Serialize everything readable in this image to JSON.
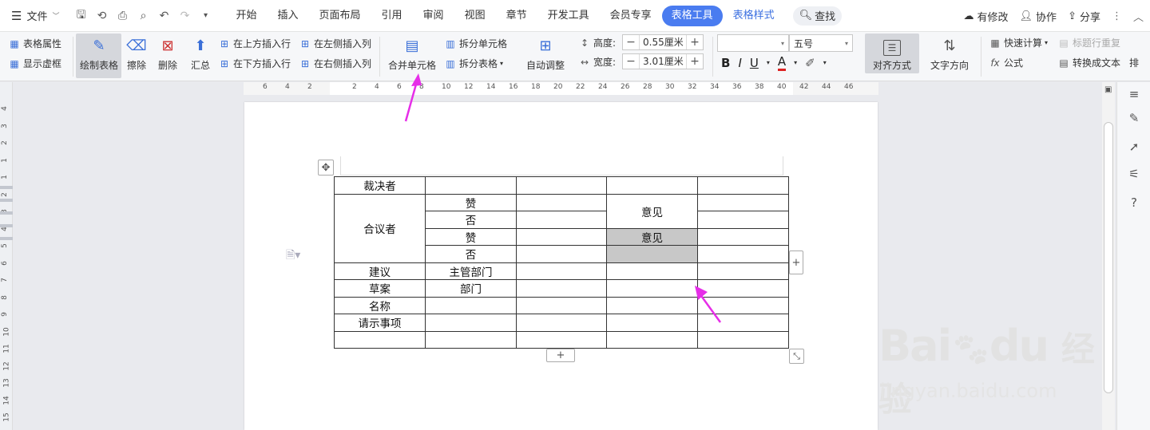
{
  "menubar": {
    "file_label": "文件",
    "tabs": [
      "开始",
      "插入",
      "页面布局",
      "引用",
      "审阅",
      "视图",
      "章节",
      "开发工具",
      "会员专享"
    ],
    "active_tab": "表格工具",
    "style_tab": "表格样式",
    "search_label": "查找",
    "right_items": {
      "modified": "有修改",
      "collab": "协作",
      "share": "分享"
    }
  },
  "ribbon": {
    "table_props": "表格属性",
    "show_gridlines": "显示虚框",
    "draw_table": "绘制表格",
    "erase": "擦除",
    "delete": "删除",
    "summary": "汇总",
    "insert_row_above": "在上方插入行",
    "insert_row_below": "在下方插入行",
    "insert_col_left": "在左侧插入列",
    "insert_col_right": "在右侧插入列",
    "merge_cells": "合并单元格",
    "split_cells": "拆分单元格",
    "split_table": "拆分表格",
    "auto_fit": "自动调整",
    "height_label": "高度:",
    "height_value": "0.55厘米",
    "width_label": "宽度:",
    "width_value": "3.01厘米",
    "font_name": "",
    "font_size": "五号",
    "align_label": "对齐方式",
    "text_direction": "文字方向",
    "quick_calc": "快速计算",
    "repeat_header": "标题行重复",
    "formula": "公式",
    "to_text": "转换成文本",
    "more": "排"
  },
  "ruler": {
    "h_numbers": [
      "6",
      "4",
      "2",
      "2",
      "4",
      "6",
      "8",
      "10",
      "12",
      "14",
      "16",
      "18",
      "20",
      "22",
      "24",
      "26",
      "28",
      "30",
      "32",
      "34",
      "36",
      "38",
      "40",
      "42",
      "44",
      "46"
    ],
    "v_numbers": [
      "4",
      "3",
      "2",
      "1",
      "1",
      "2",
      "3",
      "4",
      "5",
      "6",
      "7",
      "8",
      "9",
      "10",
      "11",
      "12",
      "13",
      "14",
      "15"
    ]
  },
  "table": {
    "rows": [
      [
        "裁决者",
        "",
        "",
        "",
        ""
      ],
      [
        "合议者",
        "赞",
        "",
        "意见",
        ""
      ],
      [
        "",
        "否",
        "",
        "",
        ""
      ],
      [
        "",
        "赞",
        "",
        "意见",
        ""
      ],
      [
        "",
        "否",
        "",
        "",
        ""
      ],
      [
        "建议",
        "主管部门",
        "",
        "",
        ""
      ],
      [
        "草案",
        "部门",
        "",
        "",
        ""
      ],
      [
        "名称",
        "",
        "",
        "",
        ""
      ],
      [
        "请示事项",
        "",
        "",
        "",
        ""
      ],
      [
        "",
        "",
        "",
        "",
        ""
      ]
    ]
  },
  "watermark": {
    "brand": "Bai",
    "brand2": "du",
    "cn": "经验",
    "url": "jingyan.baidu.com"
  }
}
